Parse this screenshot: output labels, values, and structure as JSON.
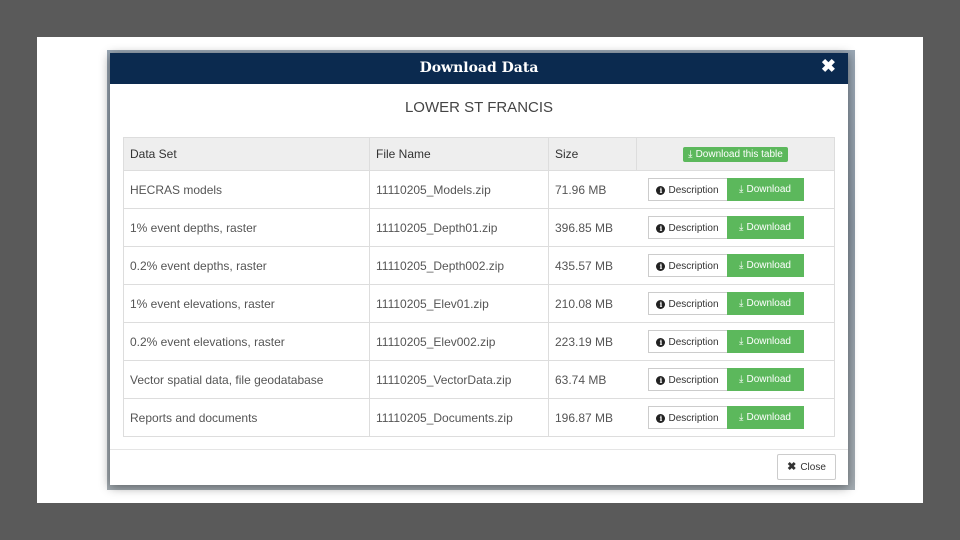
{
  "modal": {
    "title": "Download Data",
    "close_glyph": "✖",
    "area_name": "LOWER ST FRANCIS"
  },
  "table": {
    "headers": [
      "Data Set",
      "File Name",
      "Size"
    ],
    "download_table_label": "Download this table",
    "description_label": "Description",
    "download_label": "Download",
    "rows": [
      {
        "dataset": "HECRAS models",
        "file": "11110205_Models.zip",
        "size": "71.96 MB"
      },
      {
        "dataset": "1% event depths, raster",
        "file": "11110205_Depth01.zip",
        "size": "396.85 MB"
      },
      {
        "dataset": "0.2% event depths, raster",
        "file": "11110205_Depth002.zip",
        "size": "435.57 MB"
      },
      {
        "dataset": "1% event elevations, raster",
        "file": "11110205_Elev01.zip",
        "size": "210.08 MB"
      },
      {
        "dataset": "0.2% event elevations, raster",
        "file": "11110205_Elev002.zip",
        "size": "223.19 MB"
      },
      {
        "dataset": "Vector spatial data, file geodatabase",
        "file": "11110205_VectorData.zip",
        "size": "63.74 MB"
      },
      {
        "dataset": "Reports and documents",
        "file": "11110205_Documents.zip",
        "size": "196.87 MB"
      }
    ]
  },
  "footer": {
    "close_label": "Close"
  },
  "icons": {
    "info": "info-circle-icon",
    "download": "download-icon",
    "close": "close-icon"
  },
  "colors": {
    "header_bg": "#0b2a4f",
    "download_green": "#5cb85c"
  }
}
